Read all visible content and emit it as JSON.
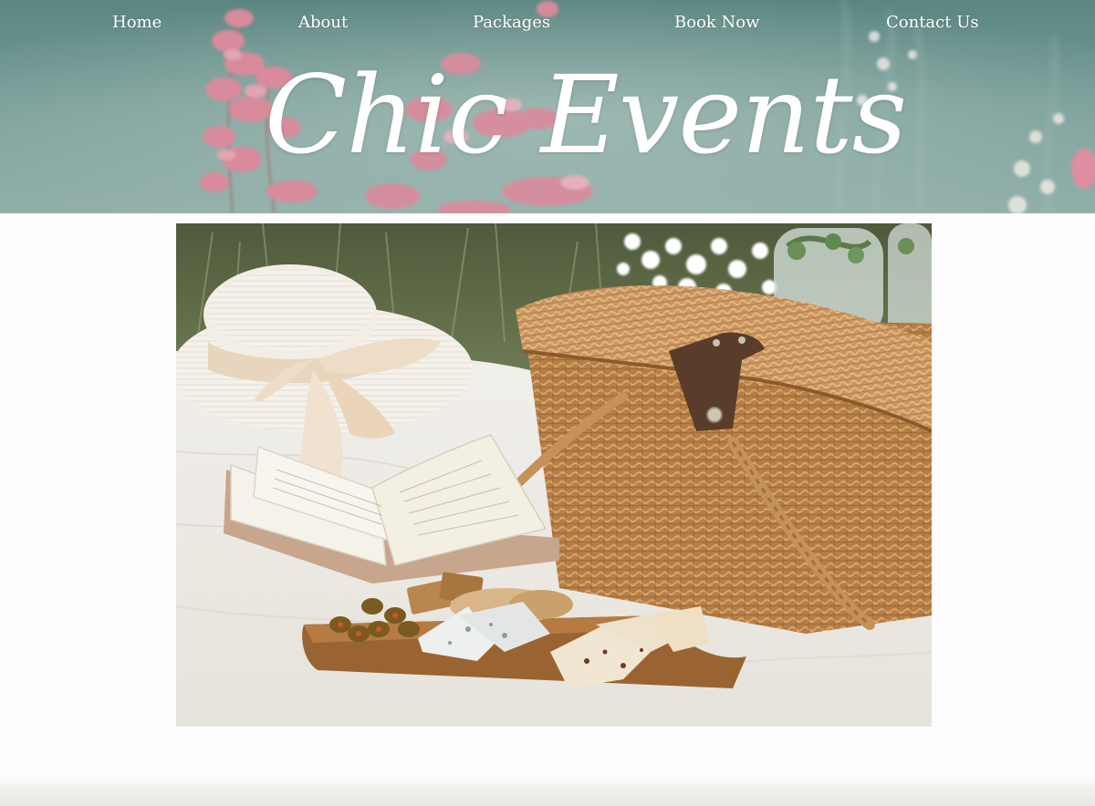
{
  "nav": {
    "items": [
      {
        "label": "Home"
      },
      {
        "label": "About"
      },
      {
        "label": "Packages"
      },
      {
        "label": "Book Now"
      },
      {
        "label": "Contact Us"
      }
    ]
  },
  "hero": {
    "brand_title": "Chic Events"
  },
  "colors": {
    "hero_teal": "#6f9893",
    "flower_pink": "#d9849a",
    "nav_text": "#ffffff",
    "page_bg": "#fdfdfd",
    "wicker": "#b07a42"
  },
  "feature_image": {
    "subject": "picnic-scene"
  }
}
